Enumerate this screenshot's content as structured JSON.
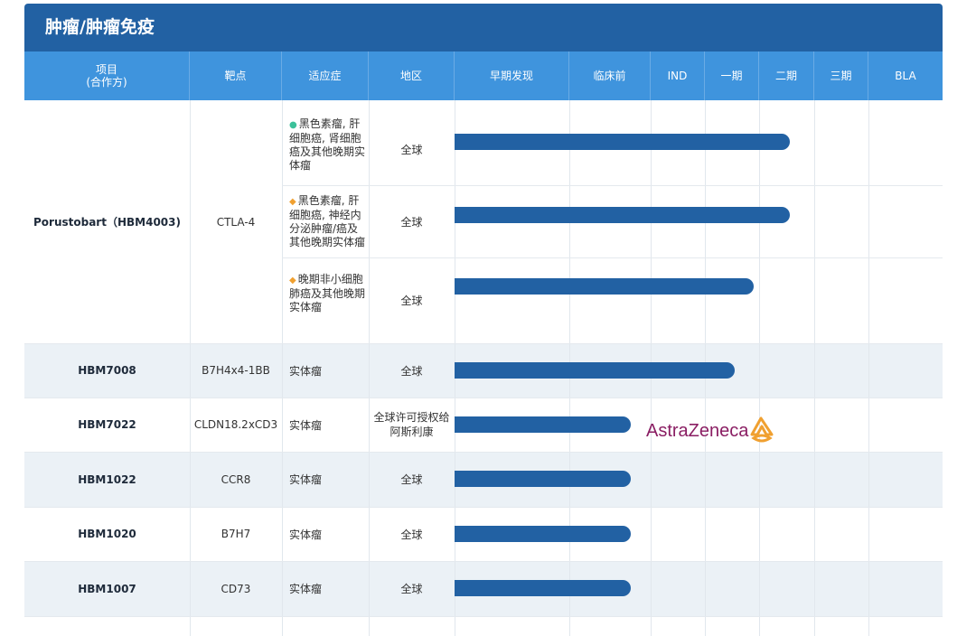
{
  "section_title": "肿瘤/肿瘤免疫",
  "columns": [
    "项目\n(合作方)",
    "靶点",
    "适应症",
    "地区",
    "早期发现",
    "临床前",
    "IND",
    "一期",
    "二期",
    "三期",
    "BLA"
  ],
  "colors": {
    "title_bar": "#2261a3",
    "header": "#3f94dd",
    "bar": "#2261a3",
    "alt_row": "#ebf1f6",
    "dot_green": "#3cc19a",
    "dot_orange": "#f0a030",
    "partner_logo": "#8a1e63"
  },
  "stages": [
    "早期发现",
    "临床前",
    "IND",
    "一期",
    "二期",
    "三期",
    "BLA"
  ],
  "pipeline": [
    {
      "project": "Porustobart（HBM4003)",
      "target": "CTLA-4",
      "indications": [
        {
          "marker": "●",
          "marker_color": "green",
          "text": "黑色素瘤, 肝细胞癌, 肾细胞癌及其他晚期实体瘤",
          "region": "全球",
          "progress_stage": "二期",
          "progress_fraction": 0.55
        },
        {
          "marker": "◆",
          "marker_color": "orange",
          "text": "黑色素瘤, 肝细胞癌, 神经内分泌肿瘤/癌及其他晚期实体瘤",
          "region": "全球",
          "progress_stage": "二期",
          "progress_fraction": 0.55
        },
        {
          "marker": "◆",
          "marker_color": "orange",
          "text": "晚期非小细胞肺癌及其他晚期实体瘤",
          "region": "全球",
          "progress_stage": "一期",
          "progress_fraction": 0.9
        }
      ]
    },
    {
      "project": "HBM7008",
      "target": "B7H4x4-1BB",
      "indication": "实体瘤",
      "region": "全球",
      "progress_stage": "一期",
      "progress_fraction": 0.55
    },
    {
      "project": "HBM7022",
      "target": "CLDN18.2xCD3",
      "indication": "实体瘤",
      "region": "全球许可授权给阿斯利康",
      "progress_stage": "临床前",
      "progress_fraction": 0.75,
      "partner_logo": "AstraZeneca"
    },
    {
      "project": "HBM1022",
      "target": "CCR8",
      "indication": "实体瘤",
      "region": "全球",
      "progress_stage": "临床前",
      "progress_fraction": 0.75
    },
    {
      "project": "HBM1020",
      "target": "B7H7",
      "indication": "实体瘤",
      "region": "全球",
      "progress_stage": "临床前",
      "progress_fraction": 0.75
    },
    {
      "project": "HBM1007",
      "target": "CD73",
      "indication": "实体瘤",
      "region": "全球",
      "progress_stage": "临床前",
      "progress_fraction": 0.75
    }
  ]
}
